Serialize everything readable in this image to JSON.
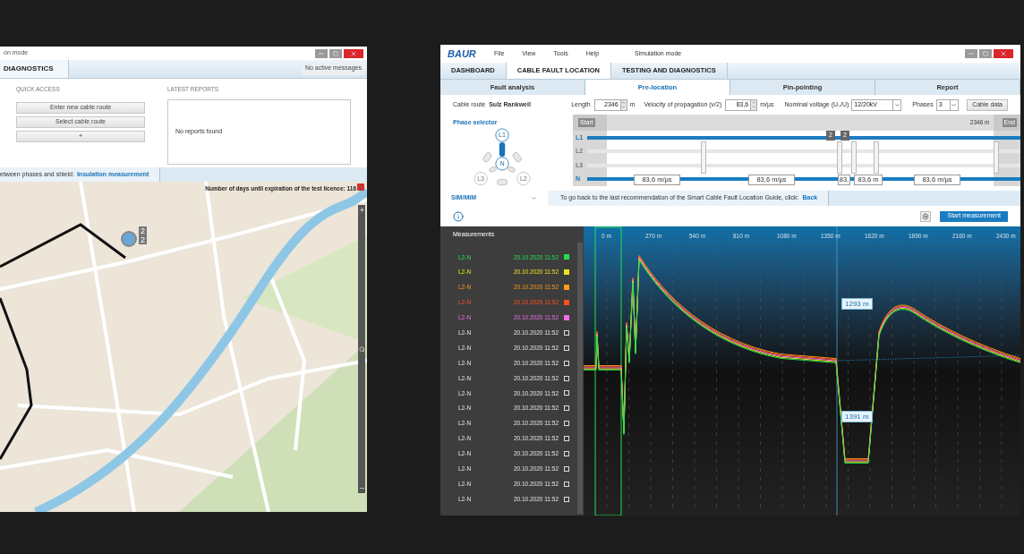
{
  "left_window": {
    "title": "on mode",
    "tab": "DIAGNOSTICS",
    "messages": "No active messages",
    "quick_access": {
      "heading": "QUICK ACCESS",
      "buttons": [
        "Enter new cable route",
        "Select cable route",
        "+"
      ]
    },
    "latest_reports": {
      "heading": "LATEST REPORTS",
      "empty_text": "No reports found"
    },
    "guide": {
      "text": "etween phases and shield:",
      "link": "Insulation measurement"
    },
    "map": {
      "licence_notice": "Number of days until expiration of the test licence: 116",
      "marker_counts": [
        "2",
        "2"
      ]
    }
  },
  "right_window": {
    "logo": "BAUR",
    "menu": [
      "File",
      "View",
      "Tools",
      "Help"
    ],
    "mode": "Simulation mode",
    "tabs": [
      {
        "label": "DASHBOARD",
        "selected": false
      },
      {
        "label": "CABLE FAULT LOCATION",
        "selected": true
      },
      {
        "label": "TESTING AND DIAGNOSTICS",
        "selected": false
      }
    ],
    "steps": [
      {
        "label": "Fault analysis",
        "selected": false
      },
      {
        "label": "Pre-location",
        "selected": true
      },
      {
        "label": "Pin-pointing",
        "selected": false
      },
      {
        "label": "Report",
        "selected": false
      }
    ],
    "cable": {
      "route_label": "Cable route",
      "route": "Sulz Rankweil",
      "length_label": "Length",
      "length": "2346",
      "length_unit": "m",
      "velocity_label": "Velocity of propagation (v/2)",
      "velocity": "83,6",
      "velocity_unit": "m/µs",
      "voltage_label": "Nominal voltage (U₀/U)",
      "voltage": "12/20kV",
      "phases_label": "Phases",
      "phases": "3",
      "cable_data_button": "Cable data"
    },
    "phase_selector": {
      "title": "Phase selector",
      "nodes": [
        "L1",
        "N",
        "L3",
        "L2"
      ]
    },
    "cable_diagram": {
      "start": "Start",
      "end": "End",
      "end_length": "2346 m",
      "lines": [
        {
          "label": "L1",
          "active": true
        },
        {
          "label": "L2",
          "active": false
        },
        {
          "label": "L3",
          "active": false
        },
        {
          "label": "N",
          "active": true
        }
      ],
      "fault_badges": [
        "2",
        "2"
      ],
      "velocity_tags": [
        "83,6 m/µs",
        "83,6 m/µs",
        "83,",
        "83,6 m",
        "83,6 m/µs"
      ]
    },
    "mode_select": "SIM/MIM",
    "guide": {
      "text": "To go back to the last recommendation of the Smart Cable Fault Location Guide, click:",
      "link": "Back"
    },
    "start_button": "Start measurement",
    "measurements": {
      "title": "Measurements",
      "rows": [
        {
          "phase": "L2-N",
          "time": "20.10.2020 11:52",
          "checked": true,
          "color": "#22e04a"
        },
        {
          "phase": "L2-N",
          "time": "20.10.2020 11:52",
          "checked": true,
          "color": "#f2e21c"
        },
        {
          "phase": "L2-N",
          "time": "20.10.2020 11:52",
          "checked": true,
          "color": "#ff9a1a"
        },
        {
          "phase": "L2-N",
          "time": "20.10.2020 11:52",
          "checked": true,
          "color": "#ff4f1f"
        },
        {
          "phase": "L2-N",
          "time": "20.10.2020 11:52",
          "checked": true,
          "color": "#ee6ee8"
        },
        {
          "phase": "L2-N",
          "time": "20.10.2020 11:52",
          "checked": false
        },
        {
          "phase": "L2-N",
          "time": "20.10.2020 11:52",
          "checked": false
        },
        {
          "phase": "L2-N",
          "time": "20.10.2020 11:52",
          "checked": false
        },
        {
          "phase": "L2-N",
          "time": "20.10.2020 11:52",
          "checked": false
        },
        {
          "phase": "L2-N",
          "time": "20.10.2020 11:52",
          "checked": false
        },
        {
          "phase": "L2-N",
          "time": "20.10.2020 11:52",
          "checked": false
        },
        {
          "phase": "L2-N",
          "time": "20.10.2020 11:52",
          "checked": false
        },
        {
          "phase": "L2-N",
          "time": "20.10.2020 11:52",
          "checked": false
        },
        {
          "phase": "L2-N",
          "time": "20.10.2020 11:52",
          "checked": false
        },
        {
          "phase": "L2-N",
          "time": "20.10.2020 11:52",
          "checked": false
        },
        {
          "phase": "L2-N",
          "time": "20.10.2020 11:52",
          "checked": false
        },
        {
          "phase": "L2-N",
          "time": "20.10.2020 11:52",
          "checked": false
        }
      ]
    },
    "trace": {
      "axis_labels": [
        "0 m",
        "270 m",
        "540 m",
        "810 m",
        "1080 m",
        "1350 m",
        "1620 m",
        "1890 m",
        "2160 m",
        "2430 m"
      ],
      "cursors": [
        "1293 m",
        "1391 m"
      ]
    }
  }
}
